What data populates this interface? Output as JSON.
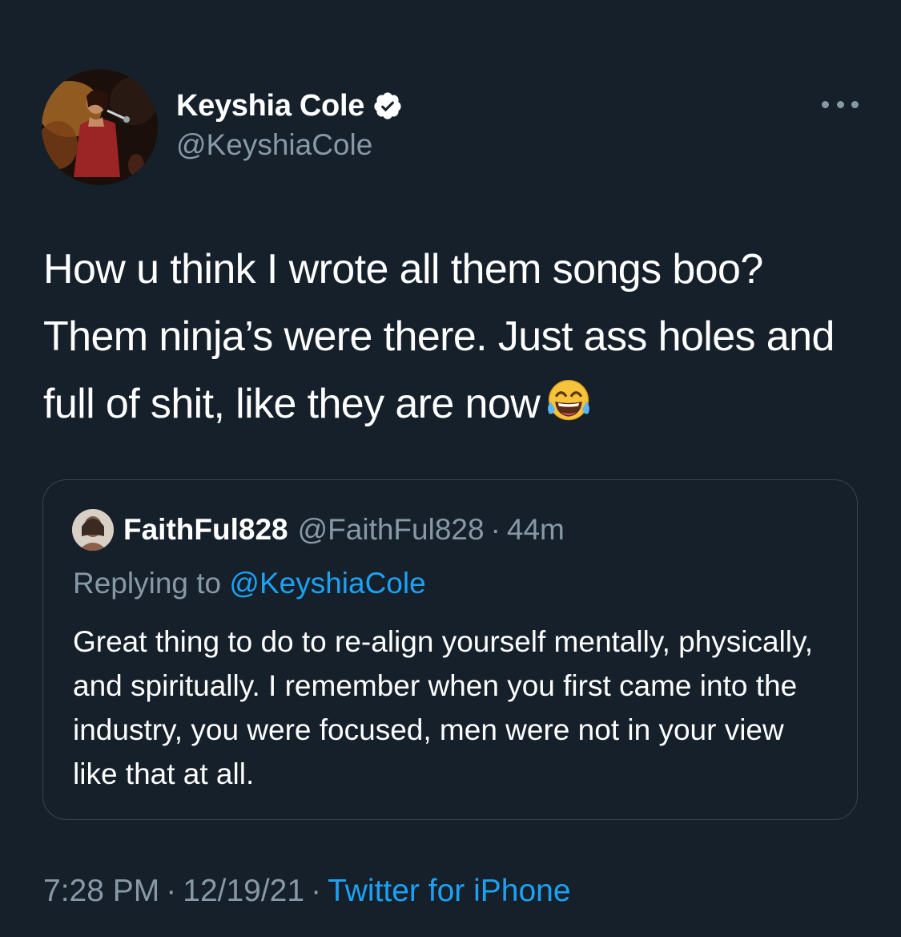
{
  "tweet": {
    "author": {
      "display_name": "Keyshia Cole",
      "handle": "@KeyshiaCole",
      "verified_icon": "verified-badge-icon",
      "avatar_icon": "profile-photo"
    },
    "more_icon": "more-options-icon",
    "text": "How u think I wrote all them songs boo? Them ninja’s were there. Just ass holes and full of shit, like they are now",
    "emoji_icon": "face-with-tears-of-joy-emoji",
    "quoted_tweet": {
      "display_name": "FaithFul828",
      "handle": "@FaithFul828",
      "separator": "·",
      "time": "44m",
      "replying_prefix": "Replying to",
      "replying_to": "@KeyshiaCole",
      "text": "Great thing to do to re-align yourself mentally, physically, and spiritually. I remember when you first came into the industry, you were focused, men were not in your view like that at all."
    },
    "footer": {
      "time": "7:28 PM",
      "separator": "·",
      "date": "12/19/21",
      "source": "Twitter for iPhone"
    }
  },
  "colors": {
    "background": "#15202b",
    "text": "#ffffff",
    "secondary": "#8899a6",
    "accent": "#1da1f2",
    "border": "#38444d"
  }
}
